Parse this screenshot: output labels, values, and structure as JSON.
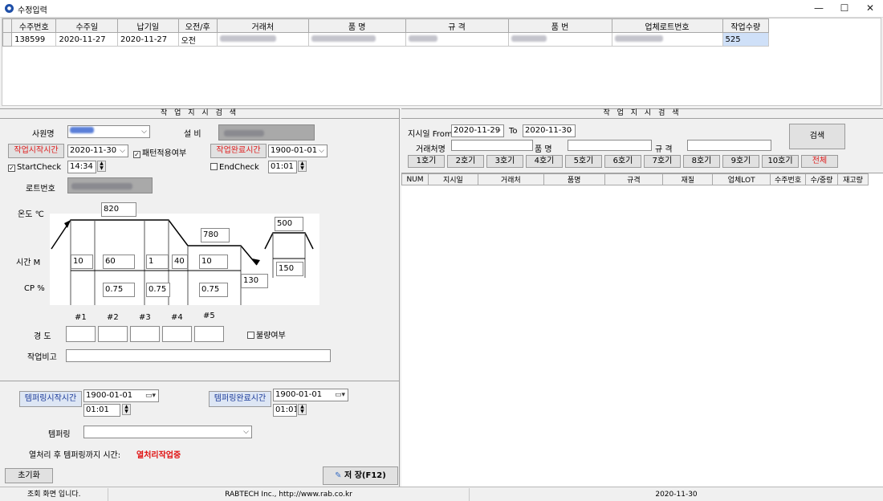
{
  "window": {
    "title": "수정입력",
    "minimize": "—",
    "maximize": "☐",
    "close": "✕"
  },
  "grid": {
    "columns": [
      "수주번호",
      "수주일",
      "납기일",
      "오전/후",
      "거래처",
      "품 명",
      "규 격",
      "품 번",
      "업체로트번호",
      "작업수량"
    ],
    "row": {
      "order_no": "138599",
      "order_date": "2020-11-27",
      "due_date": "2020-11-27",
      "ampm": "오전",
      "qty": "525"
    }
  },
  "left": {
    "title": "작 업 지 시 검 색",
    "employee_label": "사원명",
    "equipment_label": "설 비",
    "start_time_btn": "작업시작시간",
    "start_date": "2020-11-30",
    "pattern_check": "패턴적용여부",
    "end_time_btn": "작업완료시간",
    "end_date": "1900-01-01",
    "start_check": "StartCheck",
    "start_clock": "14:34",
    "end_check": "EndCheck",
    "end_clock": "01:01",
    "lot_label": "로트번호",
    "temp_label": "온도 ℃",
    "time_label": "시간 M",
    "cp_label": "CP %",
    "profile": {
      "t1": "820",
      "t2": "780",
      "t3": "500",
      "t4": "130",
      "t5": "150",
      "m1": "10",
      "m2": "60",
      "m3": "1",
      "m4": "40",
      "m5": "10",
      "cp1": "0.75",
      "cp2": "0.75",
      "cp3": "0.75"
    },
    "hardness_label": "경 도",
    "hardness_nums": [
      "#1",
      "#2",
      "#3",
      "#4",
      "#5"
    ],
    "defect_check": "불량여부",
    "remark_label": "작업비고",
    "temper_start_btn": "템퍼링시작시간",
    "temper_start_date": "1900-01-01",
    "temper_start_clock": "01:01",
    "temper_end_btn": "템퍼링완료시간",
    "temper_end_date": "1900-01-01",
    "temper_end_clock": "01:01",
    "tempering_label": "템퍼링",
    "heat_label": "열처리 후 템퍼링까지 시간:",
    "heat_status": "열처리작업중",
    "reset_btn": "초기화",
    "save_btn": "저 장(F12)"
  },
  "right": {
    "title": "작 업 지 시 검 색",
    "date_label": "지시일 From",
    "date_from": "2020-11-29",
    "to_label": "To",
    "date_to": "2020-11-30",
    "search_btn": "검색",
    "customer_label": "거래처명",
    "product_label": "품 명",
    "spec_label": "규 격",
    "machines": [
      "1호기",
      "2호기",
      "3호기",
      "4호기",
      "5호기",
      "6호기",
      "7호기",
      "8호기",
      "9호기",
      "10호기"
    ],
    "all_btn": "전체",
    "columns": [
      "NUM",
      "지시일",
      "거래처",
      "품명",
      "규격",
      "재질",
      "업체LOT",
      "수주번호",
      "수/중량",
      "재고량"
    ]
  },
  "status": {
    "msg": "조회 화면 입니다.",
    "company": "RABTECH Inc., http://www.rab.co.kr",
    "date": "2020-11-30"
  }
}
